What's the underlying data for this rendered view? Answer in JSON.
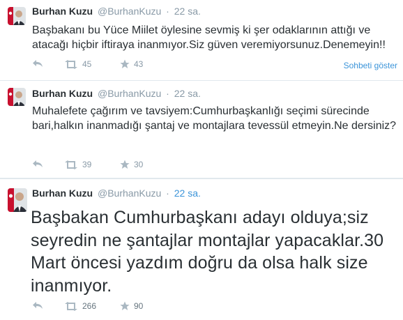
{
  "colors": {
    "link": "#3b94d9",
    "muted": "#8899a6",
    "text": "#292f33",
    "divider": "#e1e8ed"
  },
  "tweets": [
    {
      "fullname": "Burhan Kuzu",
      "username": "@BurhanKuzu",
      "separator": "·",
      "time": "22 sa.",
      "text": "Başbakanı bu Yüce Miilet öylesine sevmiş ki şer odaklarının attığı ve atacağı hiçbir iftiraya inanmıyor.Siz güven veremiyorsunuz.Denemeyin!!",
      "retweets": "45",
      "favorites": "43",
      "expand_label": "Sohbeti göster"
    },
    {
      "fullname": "Burhan Kuzu",
      "username": "@BurhanKuzu",
      "separator": "·",
      "time": "22 sa.",
      "text": "Muhalefete çağırım ve tavsiyem:Cumhurbaşkanlığı seçimi sürecinde bari,halkın inanmadığı şantaj ve montajlara tevessül etmeyin.Ne dersiniz?",
      "retweets": "39",
      "favorites": "30"
    },
    {
      "fullname": "Burhan Kuzu",
      "username": "@BurhanKuzu",
      "separator": "·",
      "time": "22 sa.",
      "text": "Başbakan Cumhurbaşkanı adayı olduya;siz seyredin ne şantajlar montajlar yapacaklar.30 Mart öncesi yazdım doğru da olsa halk size inanmıyor.",
      "retweets": "266",
      "favorites": "90"
    }
  ],
  "icons": {
    "reply": "reply-icon",
    "retweet": "retweet-icon",
    "favorite": "star-icon",
    "avatar": "avatar"
  }
}
